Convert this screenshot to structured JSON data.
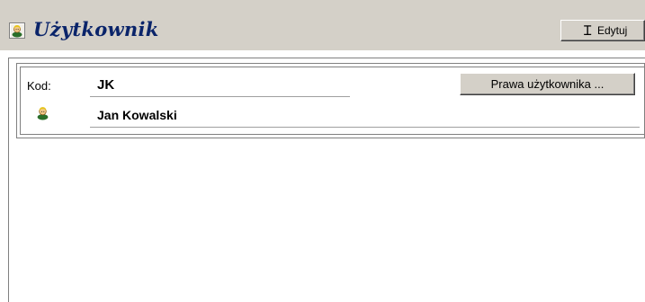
{
  "header": {
    "title": "Użytkownik",
    "icon": "user-icon",
    "edit_button": {
      "label": "Edytuj",
      "icon": "text-cursor-icon"
    }
  },
  "user": {
    "code_label": "Kod:",
    "code": "JK",
    "name_icon": "user-icon",
    "name": "Jan Kowalski",
    "rights_button": "Prawa użytkownika ..."
  },
  "colors": {
    "title": "#0a246a",
    "header_background": "#d4d0c8",
    "button_face": "#d4d0c8"
  }
}
